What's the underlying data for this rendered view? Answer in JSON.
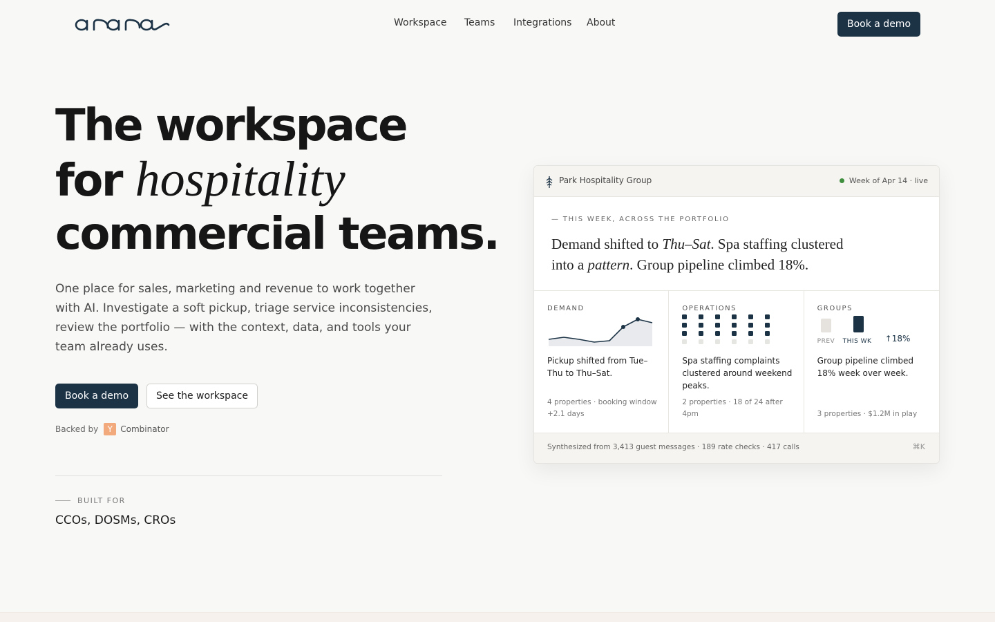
{
  "header": {
    "logo_text": "anana",
    "nav": [
      "Workspace",
      "Teams",
      "Integrations",
      "About"
    ],
    "cta": "Book a demo"
  },
  "hero": {
    "title_line1": "The workspace",
    "title_line2_plain": "for",
    "title_line2_italic": "hospitality",
    "title_line3": "commercial teams.",
    "description": "One place for sales, marketing and revenue to work together with AI. Investigate a soft pickup, triage service inconsistencies, review the portfolio — with the context, data, and tools your team already uses.",
    "cta_primary": "Book a demo",
    "cta_secondary": "See the workspace",
    "backed_by": "Backed by",
    "yc_letter": "Y",
    "yc_name": "Combinator",
    "built_for_label": "BUILT FOR",
    "built_for_roles": "CCOs, DOSMs, CROs"
  },
  "card": {
    "org": "Park Hospitality Group",
    "week": "Week of Apr 14 · live",
    "eyebrow": "— THIS WEEK, ACROSS THE PORTFOLIO",
    "summary": {
      "s1": "Demand shifted to ",
      "s1_italic": "Thu–Sat",
      "s2": ". Spa staffing clustered into a ",
      "s2_italic": "pattern",
      "s3": ". Group pipeline climbed 18%."
    },
    "columns": [
      {
        "heading": "DEMAND",
        "text": "Pickup shifted from Tue–Thu to Thu–Sat.",
        "meta": "4 properties · booking window +2.1 days"
      },
      {
        "heading": "OPERATIONS",
        "text": "Spa staffing complaints clustered around weekend peaks.",
        "meta": "2 properties · 18 of 24 after 4pm"
      },
      {
        "heading": "GROUPS",
        "text": "Group pipeline climbed 18% week over week.",
        "meta": "3 properties · $1.2M in play",
        "prev_label": "PREV",
        "this_label": "THIS WK",
        "change": "↑18%"
      }
    ],
    "footer": "Synthesized from 3,413 guest messages · 189 rate checks · 417 calls",
    "shortcut": "⌘K"
  },
  "colors": {
    "accent": "#1c3346",
    "background": "#f8f8f7",
    "live": "#3e8e3e",
    "yc": "#f2a97c"
  },
  "icons": [
    "tree-icon",
    "live-status-icon"
  ]
}
